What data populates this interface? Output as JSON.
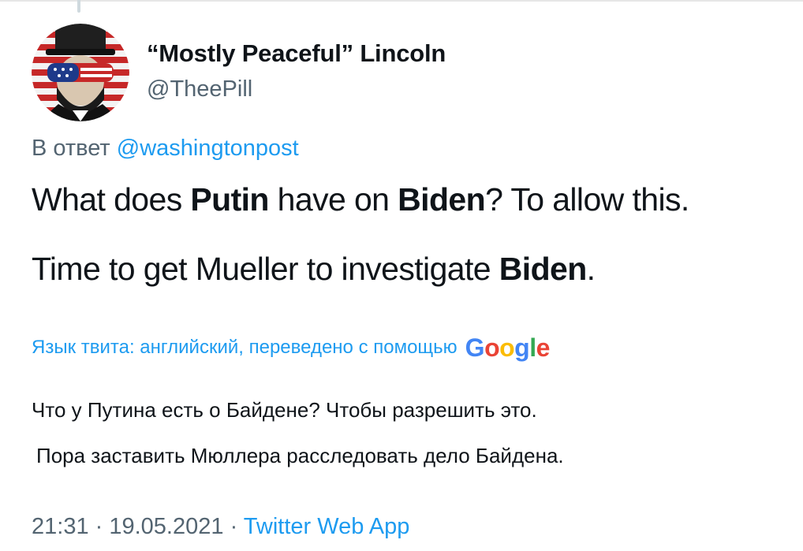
{
  "author": {
    "display_name": "“Mostly Peaceful” Lincoln",
    "handle": "@TheePill",
    "avatar_icon": "lincoln-flag-avatar-icon"
  },
  "reply": {
    "prefix": "В ответ",
    "mention": "@washingtonpost"
  },
  "tweet": {
    "line1": {
      "part1": "What does ",
      "bold1": "Putin",
      "part2": " have on ",
      "bold2": "Biden",
      "part3": "? To allow this."
    },
    "line2": {
      "part1": "Time to get Mueller to investigate ",
      "bold1": "Biden",
      "part2": "."
    }
  },
  "translation": {
    "note": "Язык твита: английский, переведено с помощью",
    "provider_letters": [
      "G",
      "o",
      "o",
      "g",
      "l",
      "e"
    ],
    "line1": "Что у Путина есть о Байдене? Чтобы разрешить это.",
    "line2": "Пора заставить Мюллера расследовать дело Байдена."
  },
  "meta": {
    "time": "21:31",
    "sep1": " · ",
    "date": "19.05.2021",
    "sep2": " · ",
    "source": "Twitter Web App"
  },
  "colors": {
    "link": "#1d9bf0",
    "secondary_text": "#536471",
    "primary_text": "#0f1419"
  }
}
